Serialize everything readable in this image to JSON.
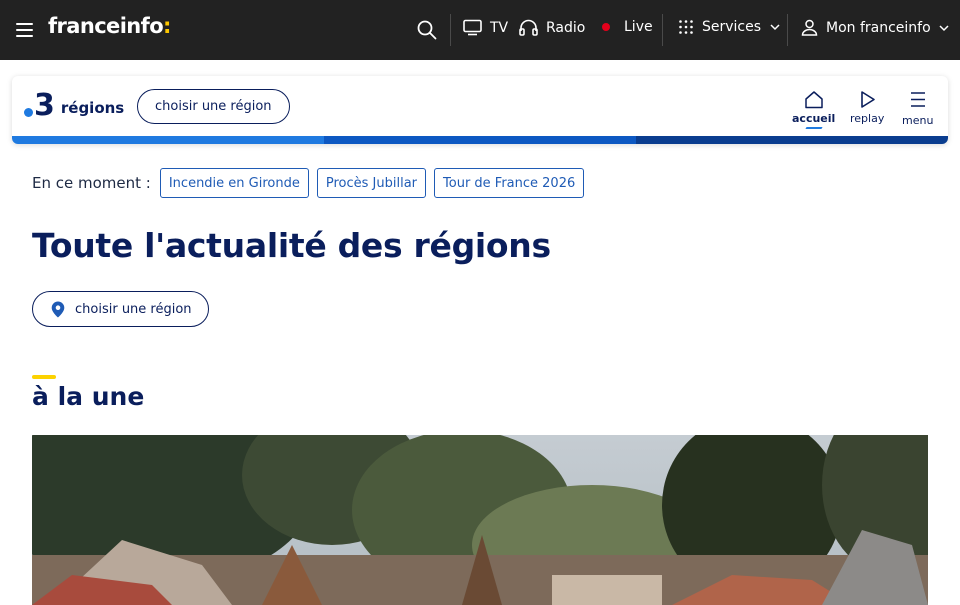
{
  "topbar": {
    "logo": "franceinfo",
    "logo_colon": ":",
    "nav": {
      "tv": "TV",
      "radio": "Radio",
      "live": "Live",
      "services": "Services",
      "account": "Mon franceinfo"
    },
    "colors": {
      "background": "#222222",
      "live_dot": "#e3001b",
      "colon": "#fcc600"
    }
  },
  "region_header": {
    "logo_number": "3",
    "logo_word": "régions",
    "choose_label": "choisir une région",
    "nav": [
      {
        "label": "accueil",
        "icon": "home-icon",
        "active": true
      },
      {
        "label": "replay",
        "icon": "play-icon",
        "active": false
      },
      {
        "label": "menu",
        "icon": "menu-icon",
        "active": false
      }
    ],
    "stripe_colors": [
      "#1f7ae0",
      "#0d58c2",
      "#0a3d8f"
    ]
  },
  "trending": {
    "lead": "En ce moment :",
    "tags": [
      "Incendie en Gironde",
      "Procès Jubillar",
      "Tour de France 2026"
    ]
  },
  "main": {
    "title": "Toute l'actualité des régions",
    "choose_region_button": "choisir une région",
    "section_title": "à la une"
  },
  "icons": {
    "hamburger": "menu-icon",
    "search": "search-icon",
    "tv": "tv-icon",
    "radio": "headphones-icon",
    "services": "grid-icon",
    "account": "user-icon",
    "location": "location-pin-icon"
  }
}
